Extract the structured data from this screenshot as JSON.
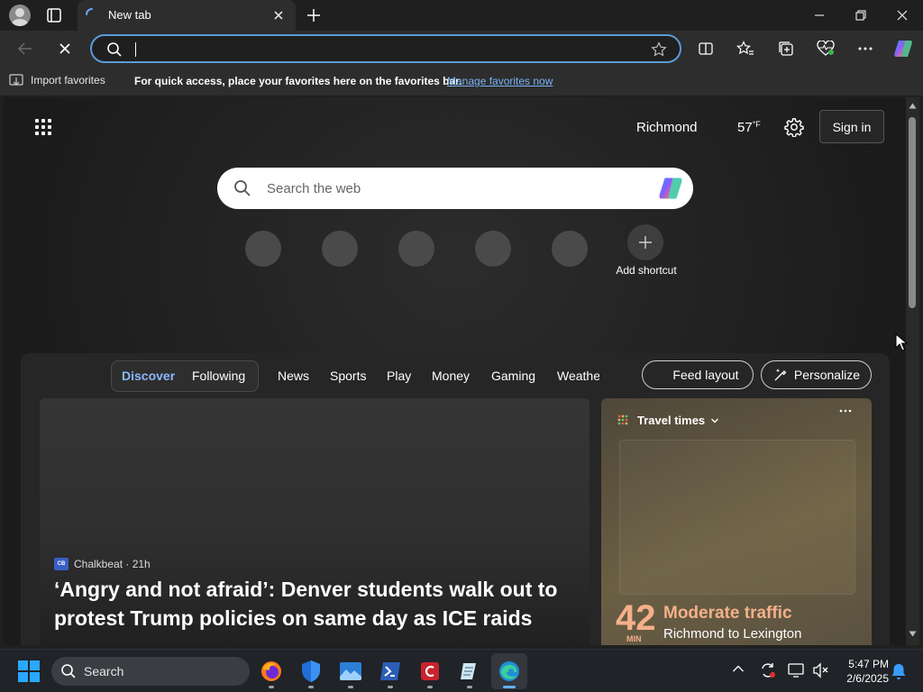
{
  "tab": {
    "title": "New tab"
  },
  "favorites_bar": {
    "import_label": "Import favorites",
    "hint": "For access, place your favorites here on the favorites bar.",
    "manage_link": "Manage favorites now"
  },
  "header": {
    "location": "Richmond",
    "temperature": "57",
    "temperature_unit": "°F",
    "signin_label": "Sign in"
  },
  "search": {
    "placeholder": "Search the web"
  },
  "shortcuts": {
    "add_label": "Add shortcut"
  },
  "feed": {
    "tabs": [
      "Discover",
      "Following",
      "News",
      "Sports",
      "Play",
      "Money",
      "Gaming",
      "Weather"
    ],
    "active_tab": "Discover",
    "feed_layout_label": "Feed layout",
    "personalize_label": "Personalize",
    "main_card": {
      "source_logo": "CB",
      "source": "Chalkbeat · 21h",
      "headline": "‘Angry and not afraid’: Denver students walk out to protest Trump policies on same day as ICE raids"
    },
    "travel_card": {
      "title": "Travel times",
      "minutes": "42",
      "minutes_label": "MIN",
      "status": "Moderate traffic",
      "route": "Richmond to Lexington"
    }
  },
  "taskbar": {
    "search_label": "Search",
    "time": "5:47 PM",
    "date": "2/6/2025"
  },
  "colors": {
    "accent": "#5b9bd8",
    "active_tab": "#8bb6ff",
    "traffic": "#f4b08a"
  }
}
